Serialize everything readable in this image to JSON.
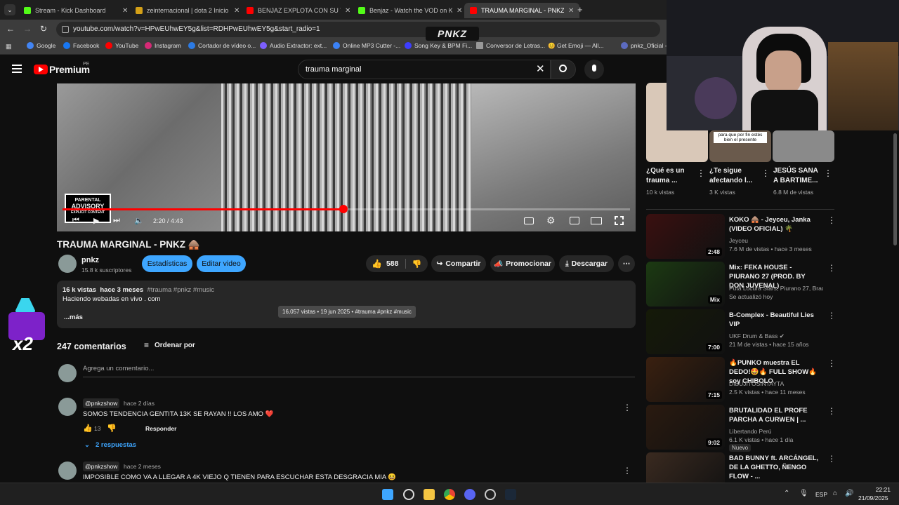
{
  "browser": {
    "tabs": [
      {
        "label": "Stream - Kick Dashboard",
        "color": "#53fc18"
      },
      {
        "label": "zeinternacional | dota 2 Inicio",
        "color": "#d4a017"
      },
      {
        "label": "BENJAZ EXPLOTA CON SU T",
        "color": "#ff0000"
      },
      {
        "label": "Benjaz - Watch the VOD on Kick",
        "color": "#53fc18"
      },
      {
        "label": "TRAUMA MARGINAL - PNKZ 🛖",
        "color": "#ff0000"
      }
    ],
    "url": "youtube.com/watch?v=HPwEUhwEY5g&list=RDHPwEUhwEY5g&start_radio=1",
    "bookmarks": [
      "Google",
      "Facebook",
      "YouTube",
      "Instagram",
      "Cortador de vídeo o...",
      "Audio Extractor: ext...",
      "Online MP3 Cutter -...",
      "Song Key & BPM Fi...",
      "Conversor de Letras...",
      "😊 Get Emoji — All...",
      "pnkz_Oficial - T"
    ]
  },
  "overlay": {
    "logo_text": "PNKZ",
    "badge": "x2"
  },
  "youtube": {
    "brand": "Premium",
    "region": "PE",
    "search_query": "trauma marginal",
    "player": {
      "time": "2:20 / 4:43",
      "progress": 0.495,
      "advisory_line1": "PARENTAL",
      "advisory_line2": "ADVISORY",
      "advisory_line3": "EXPLICIT CONTENT"
    },
    "video_title": "TRAUMA MARGINAL - PNKZ 🛖",
    "channel": {
      "name": "pnkz",
      "subs": "15.8 k suscriptores"
    },
    "buttons": {
      "stats": "Estadísticas",
      "edit": "Editar video",
      "likes": "588",
      "share": "Compartir",
      "promote": "Promocionar",
      "download": "Descargar"
    },
    "description": {
      "views": "16 k vistas",
      "ago": "hace 3 meses",
      "tags": "#trauma #pnkz #music",
      "text": "Haciendo webadas en vivo . com",
      "more": "...más",
      "tooltip": "16,057 vistas • 19 jun 2025 • #trauma #pnkz #music"
    },
    "comments": {
      "count": "247 comentarios",
      "sort": "Ordenar por",
      "placeholder": "Agrega un comentario...",
      "items": [
        {
          "user": "@pnkzshow",
          "ago": "hace 2 días",
          "text": "SOMOS TENDENCIA GENTITA 13K SE RAYAN !! LOS AMO ❤️",
          "likes": "13",
          "reply": "Responder",
          "replies": "2 respuestas"
        },
        {
          "user": "@pnkzshow",
          "ago": "hace 2 meses",
          "text": "IMPOSIBLE COMO VA A LLEGAR A 4K VIEJO Q TIENEN PARA ESCUCHAR ESTA DESGRACIA MIA 😆"
        }
      ]
    },
    "shorts": [
      {
        "title": "¿Qué es un trauma ...",
        "views": "10 k vistas"
      },
      {
        "title": "¿Te sigue afectando l...",
        "views": "3 K vistas",
        "caption": "para que por fin estés bien el presente"
      },
      {
        "title": "JESÚS SANA A BARTIME...",
        "views": "6.8 M de vistas"
      }
    ],
    "sidebar": [
      {
        "title": "KOKO 🛖 - Jeyceu, Janka (VIDEO OFICIAL) 🌴",
        "channel": "Jeyceu",
        "meta": "7.6 M de vistas • hace 3 meses",
        "duration": "2:48",
        "thumb": "#3a1010"
      },
      {
        "title": "Mix: FEKA HOUSE - PIURANO 27 (PROD. BY DON JUVENAL)",
        "channel": "Puta Locura Stars, Piurano 27, Brad Died ...",
        "meta": "Se actualizó hoy",
        "duration": "Mix",
        "thumb": "#1c3a12"
      },
      {
        "title": "B-Complex - Beautiful Lies VIP",
        "channel": "UKF Drum & Bass ✔",
        "meta": "21 M de vistas • hace 15 años",
        "duration": "7:00",
        "thumb": "#151a08"
      },
      {
        "title": "🔥PUNKO muestra EL DEDO!🤩🔥 FULL SHOW🔥 soy CHIBOLO",
        "channel": "DIBUJITOSINTAYTA",
        "meta": "2.5 K vistas • hace 11 meses",
        "duration": "7:15",
        "thumb": "#3a2010"
      },
      {
        "title": "BRUTALIDAD EL PROFE PARCHA A CURWEN | ...",
        "channel": "Libertando Perú",
        "meta": "6.1 K vistas • hace 1 día",
        "duration": "9:02",
        "badge": "Nuevo",
        "thumb": "#2a1a10"
      },
      {
        "title": "BAD BUNNY ft. ARCÁNGEL, DE LA GHETTO, ÑENGO FLOW - ...",
        "channel": "",
        "meta": "",
        "duration": "",
        "thumb": "#3a2a20"
      }
    ]
  },
  "taskbar": {
    "lang": "ESP",
    "time": "22:21",
    "date": "21/09/2025"
  },
  "colors": {
    "accent": "#ff0000",
    "blue": "#3ea6ff",
    "bg": "#0f0f0f"
  }
}
